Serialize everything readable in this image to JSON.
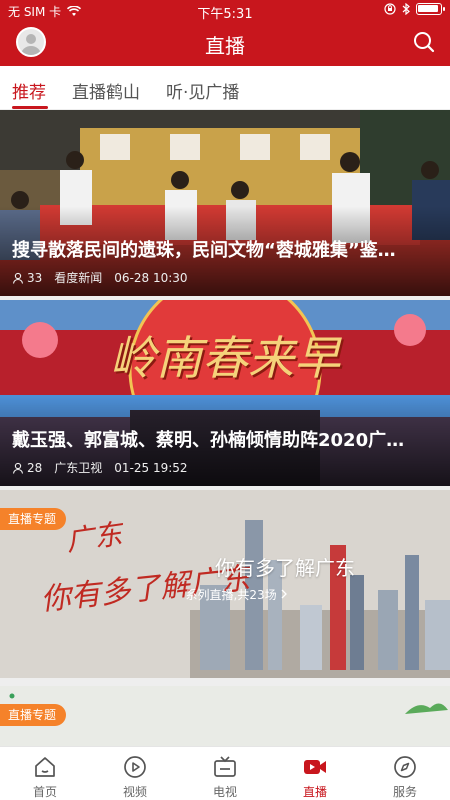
{
  "status_bar": {
    "carrier": "无 SIM 卡",
    "time": "下午5:31",
    "battery_level": 0.95
  },
  "header": {
    "title": "直播"
  },
  "tabs": [
    {
      "label": "推荐",
      "active": true
    },
    {
      "label": "直播鹤山",
      "active": false
    },
    {
      "label": "听·见广播",
      "active": false
    }
  ],
  "feed": {
    "items": [
      {
        "title": "搜寻散落民间的遗珠，民间文物“蓉城雅集”鉴…",
        "views": "33",
        "source": "看度新闻",
        "time": "06-28 10:30"
      },
      {
        "title": "戴玉强、郭富城、蔡明、孙楠倾情助阵2020广…",
        "views": "28",
        "source": "广东卫视",
        "time": "01-25 19:52",
        "image_text": "岭南春来早"
      },
      {
        "badge": "直播专题",
        "title": "你有多了解广东",
        "subtitle": "系列直播,共23场",
        "image_text": "你有多了解广东",
        "image_small_text": "广东"
      },
      {
        "badge": "直播专题"
      }
    ]
  },
  "tabbar": [
    {
      "label": "首页",
      "icon": "home-icon",
      "active": false
    },
    {
      "label": "视频",
      "icon": "play-circle-icon",
      "active": false
    },
    {
      "label": "电视",
      "icon": "tv-icon",
      "active": false
    },
    {
      "label": "直播",
      "icon": "live-camera-icon",
      "active": true
    },
    {
      "label": "服务",
      "icon": "compass-icon",
      "active": false
    }
  ],
  "colors": {
    "brand": "#c8161d",
    "badge": "#f5822a"
  }
}
